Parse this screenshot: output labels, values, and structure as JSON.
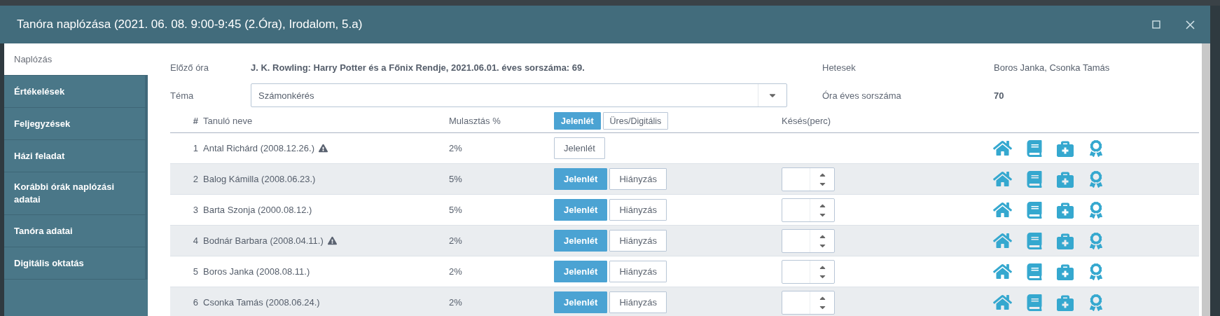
{
  "window": {
    "title": "Tanóra naplózása (2021. 06. 08. 9:00-9:45 (2.Óra), Irodalom, 5.a)"
  },
  "sidebar": {
    "items": [
      {
        "label": "Naplózás",
        "selected": true
      },
      {
        "label": "Értékelések",
        "selected": false
      },
      {
        "label": "Feljegyzések",
        "selected": false
      },
      {
        "label": "Házi feladat",
        "selected": false
      },
      {
        "label": "Korábbi órák naplózási adatai",
        "selected": false
      },
      {
        "label": "Tanóra adatai",
        "selected": false
      },
      {
        "label": "Digitális oktatás",
        "selected": false
      }
    ]
  },
  "info": {
    "previous_label": "Előző óra",
    "previous_value": "J. K. Rowling: Harry Potter és a Főnix Rendje, 2021.06.01. éves sorszáma: 69.",
    "topic_label": "Téma",
    "topic_value": "Számonkérés",
    "monitors_label": "Hetesek",
    "monitors_value": "Boros Janka, Csonka Tamás",
    "number_label": "Óra éves sorszáma",
    "number_value": "70"
  },
  "table": {
    "columns": {
      "num": "#",
      "name": "Tanuló neve",
      "absence": "Mulasztás %",
      "late": "Késés(perc)"
    },
    "header_toggle": [
      {
        "label": "Jelenlét",
        "selected": true
      },
      {
        "label": "Üres/Digitális",
        "selected": false
      }
    ],
    "rows": [
      {
        "num": "1",
        "name": "Antal Richárd (2008.12.26.)",
        "warning": true,
        "absence": "2%",
        "attendance": [
          {
            "label": "Jelenlét",
            "selected": false
          }
        ],
        "late_field": false
      },
      {
        "num": "2",
        "name": "Balog Kámilla (2008.06.23.)",
        "warning": false,
        "absence": "5%",
        "attendance": [
          {
            "label": "Jelenlét",
            "selected": true
          },
          {
            "label": "Hiányzás",
            "selected": false
          }
        ],
        "late_field": true
      },
      {
        "num": "3",
        "name": "Barta Szonja (2000.08.12.)",
        "warning": false,
        "absence": "5%",
        "attendance": [
          {
            "label": "Jelenlét",
            "selected": true
          },
          {
            "label": "Hiányzás",
            "selected": false
          }
        ],
        "late_field": true
      },
      {
        "num": "4",
        "name": "Bodnár Barbara (2008.04.11.)",
        "warning": true,
        "absence": "2%",
        "attendance": [
          {
            "label": "Jelenlét",
            "selected": true
          },
          {
            "label": "Hiányzás",
            "selected": false
          }
        ],
        "late_field": true
      },
      {
        "num": "5",
        "name": "Boros Janka (2008.08.11.)",
        "warning": false,
        "absence": "2%",
        "attendance": [
          {
            "label": "Jelenlét",
            "selected": true
          },
          {
            "label": "Hiányzás",
            "selected": false
          }
        ],
        "late_field": true
      },
      {
        "num": "6",
        "name": "Csonka Tamás (2008.06.24.)",
        "warning": false,
        "absence": "2%",
        "attendance": [
          {
            "label": "Jelenlét",
            "selected": true
          },
          {
            "label": "Hiányzás",
            "selected": false
          }
        ],
        "late_field": true
      }
    ]
  }
}
